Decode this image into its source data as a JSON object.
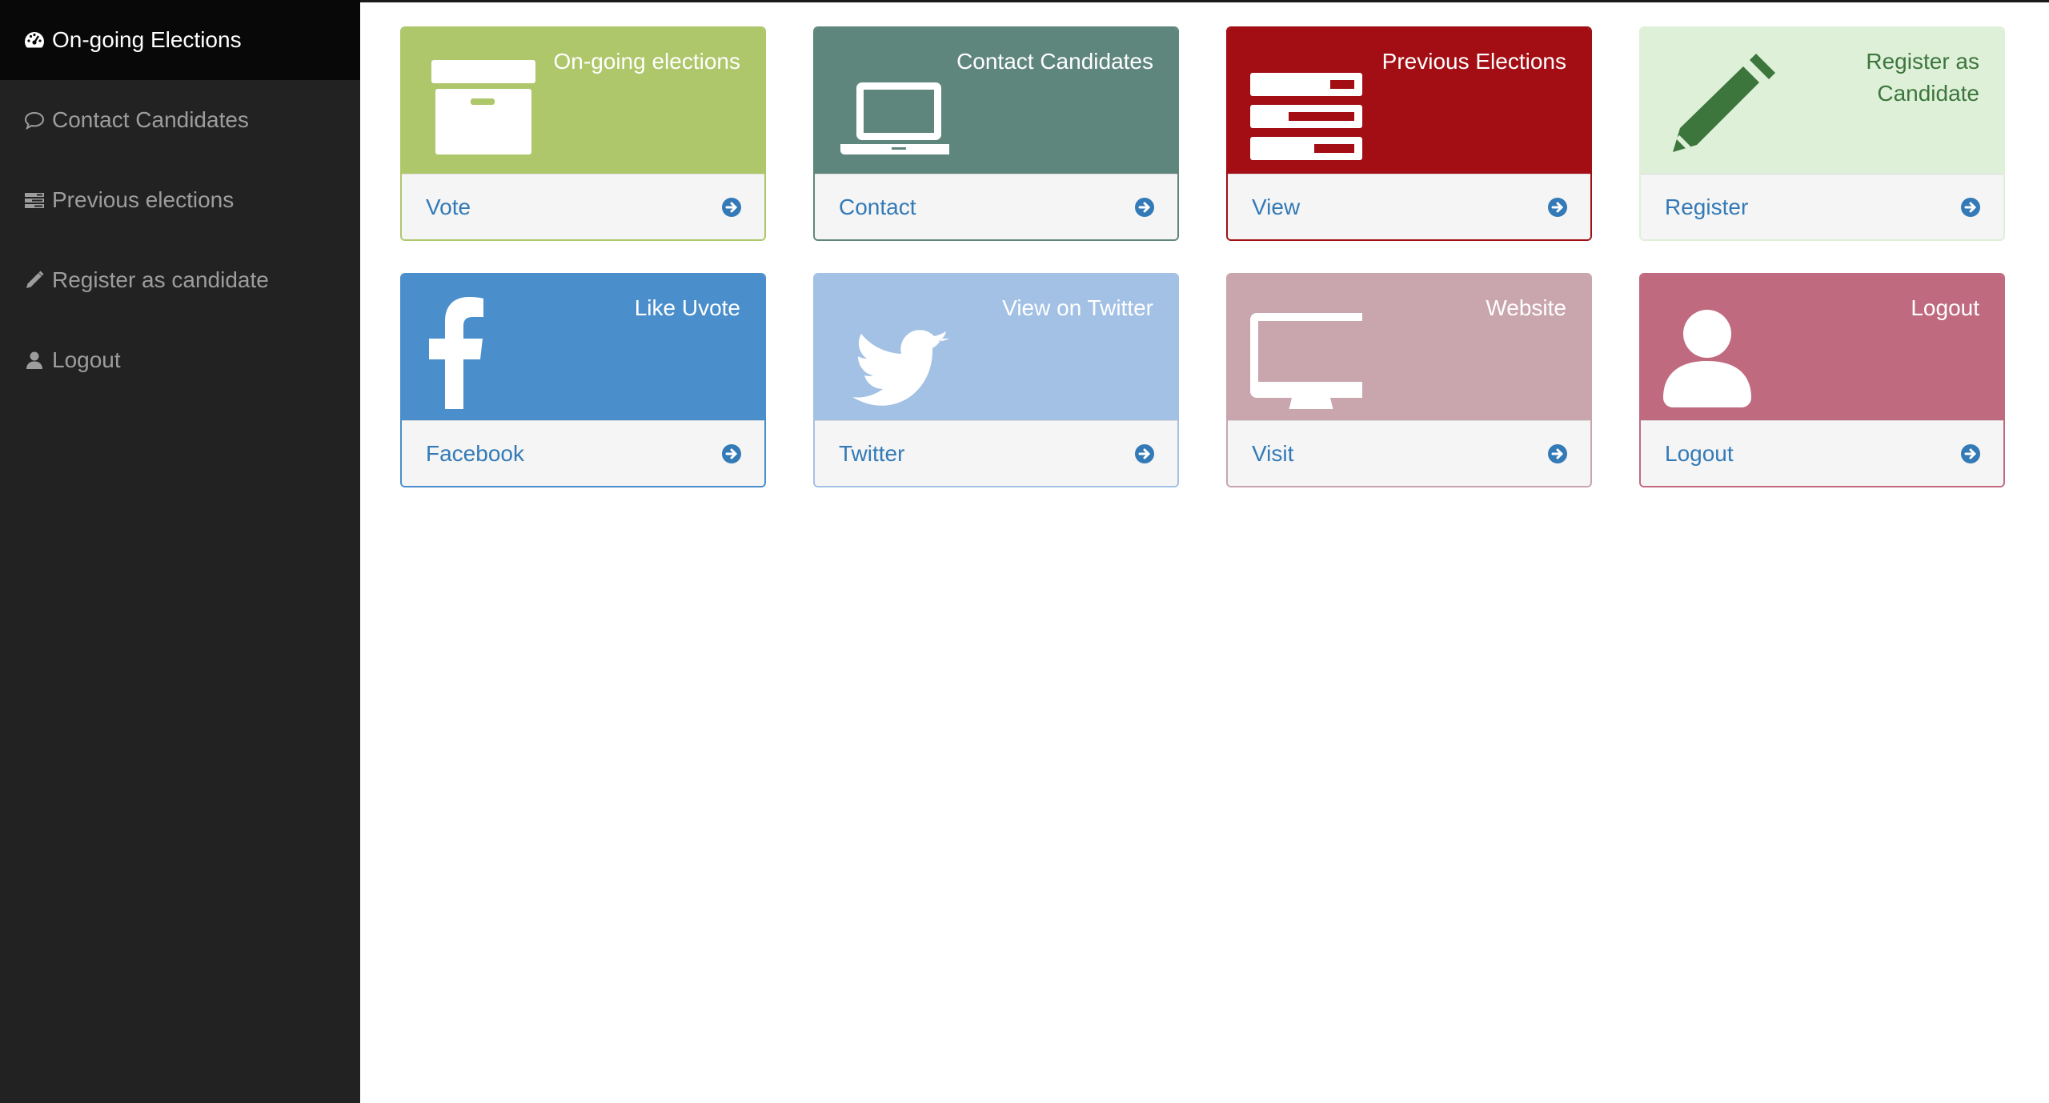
{
  "sidebar": {
    "items": [
      {
        "label": "On-going Elections",
        "icon": "dashboard-icon",
        "active": true
      },
      {
        "label": "Contact Candidates",
        "icon": "comment-icon"
      },
      {
        "label": "Previous elections",
        "icon": "list-icon"
      },
      {
        "label": "Register as candidate",
        "icon": "pencil-icon"
      },
      {
        "label": "Logout",
        "icon": "user-icon"
      }
    ]
  },
  "panels": [
    {
      "title": "On-going elections",
      "link": "Vote",
      "icon": "archive-icon",
      "color": "#aec76a",
      "text_color": "#ffffff"
    },
    {
      "title": "Contact Candidates",
      "link": "Contact",
      "icon": "laptop-icon",
      "color": "#5f867d",
      "text_color": "#ffffff"
    },
    {
      "title": "Previous Elections",
      "link": "View",
      "icon": "tasks-icon",
      "color": "#a30e14",
      "text_color": "#ffffff"
    },
    {
      "title": "Register as Candidate",
      "link": "Register",
      "icon": "pencil-icon",
      "color": "#dff0d8",
      "text_color": "#3c763d"
    },
    {
      "title": "Like Uvote",
      "link": "Facebook",
      "icon": "facebook-icon",
      "color": "#4a8ecb",
      "text_color": "#ffffff"
    },
    {
      "title": "View on Twitter",
      "link": "Twitter",
      "icon": "twitter-icon",
      "color": "#a3c1e4",
      "text_color": "#ffffff"
    },
    {
      "title": "Website",
      "link": "Visit",
      "icon": "desktop-icon",
      "color": "#c9a5ae",
      "text_color": "#ffffff"
    },
    {
      "title": "Logout",
      "link": "Logout",
      "icon": "user-icon",
      "color": "#c06a80",
      "text_color": "#ffffff"
    }
  ],
  "colors": {
    "link": "#337ab7",
    "sidebar_bg": "#222222"
  }
}
